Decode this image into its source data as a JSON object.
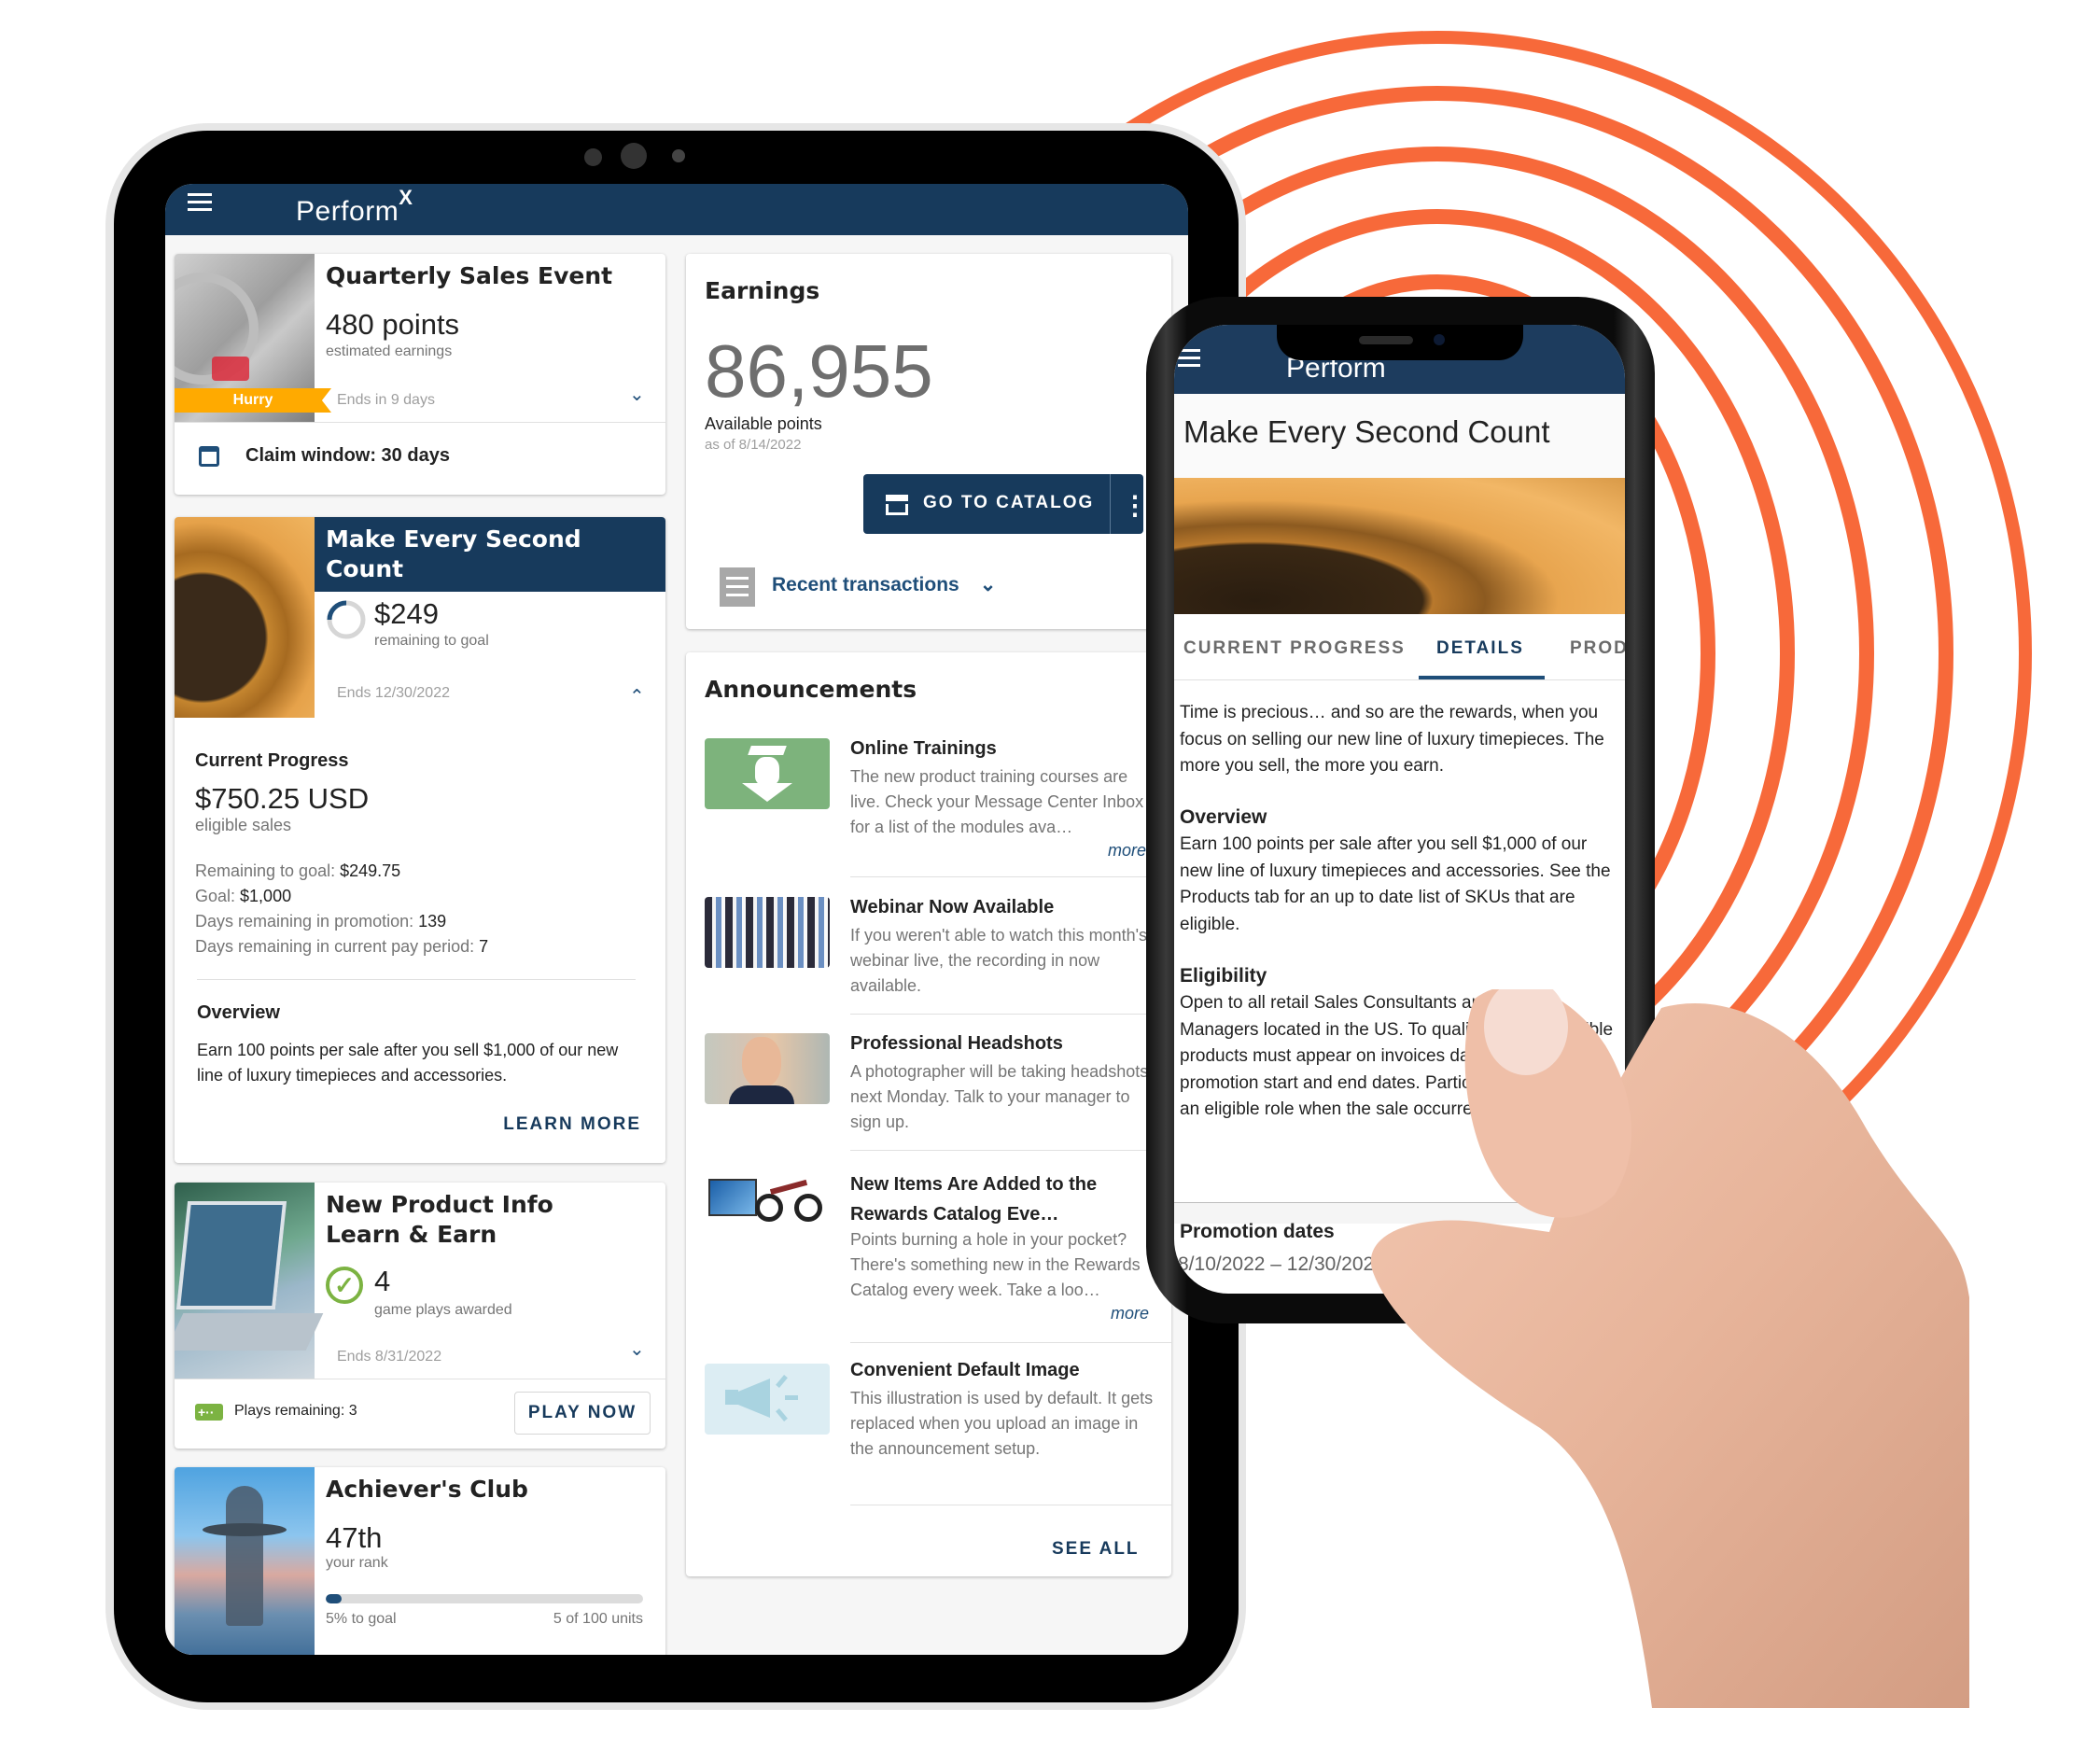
{
  "colors": {
    "brand_navy": "#173a5c",
    "accent_orange": "#f7693a",
    "hurry_yellow": "#ffaa00",
    "success_green": "#7cb342",
    "link_blue": "#1f4e79"
  },
  "tablet": {
    "app_header": {
      "logo_text": "Perform",
      "logo_super": "X",
      "menu_icon": "hamburger-icon"
    },
    "cards": {
      "quarterly": {
        "title": "Quarterly Sales Event",
        "value": "480 points",
        "value_label": "estimated earnings",
        "badge": "Hurry",
        "ends": "Ends in 9 days",
        "footer_icon": "calendar-icon",
        "footer_text": "Claim window: 30 days"
      },
      "mesc": {
        "title_line1": "Make Every Second",
        "title_line2": "Count",
        "value": "$249",
        "value_label": "remaining to goal",
        "progress_fraction": 0.75,
        "ends": "Ends 12/30/2022",
        "progress_heading": "Current Progress",
        "sales_value": "$750.25 USD",
        "sales_label": "eligible sales",
        "stats": [
          {
            "label": "Remaining to goal: ",
            "value": "$249.75"
          },
          {
            "label": "Goal: ",
            "value": "$1,000"
          },
          {
            "label": "Days remaining in promotion: ",
            "value": "139"
          },
          {
            "label": "Days remaining in current pay period: ",
            "value": "7"
          }
        ],
        "overview_heading": "Overview",
        "overview_text": "Earn 100 points per sale after you sell $1,000 of our new line of luxury timepieces and accessories.",
        "learn_more": "LEARN MORE"
      },
      "newproduct": {
        "title_line1": "New Product Info",
        "title_line2": "Learn & Earn",
        "value": "4",
        "value_label": "game plays awarded",
        "ends": "Ends 8/31/2022",
        "footer_text": "Plays remaining: 3",
        "play_button": "PLAY NOW"
      },
      "achievers": {
        "title": "Achiever's Club",
        "value": "47th",
        "value_label": "your rank",
        "progress_percent": 5,
        "progress_left": "5% to goal",
        "progress_right": "5 of 100 units"
      }
    },
    "earnings": {
      "heading": "Earnings",
      "points": "86,955",
      "points_label": "Available points",
      "as_of": "as of 8/14/2022",
      "catalog_button": "GO TO CATALOG",
      "recent_transactions": "Recent transactions"
    },
    "announcements": {
      "heading": "Announcements",
      "items": [
        {
          "title": "Online Trainings",
          "desc": "The new product training courses are live. Check your Message Center Inbox for a list of the modules ava…",
          "more": "more"
        },
        {
          "title": "Webinar Now Available",
          "desc": "If you weren't able to watch this month's webinar live, the recording in now available."
        },
        {
          "title": "Professional Headshots",
          "desc": "A photographer will be taking headshots next Monday. Talk to your manager to sign up."
        },
        {
          "title": "New Items Are Added to the Rewards Catalog Eve…",
          "desc": "Points burning a hole in your pocket? There's something new in the Rewards Catalog every week. Take a loo…",
          "more": "more"
        },
        {
          "title": "Convenient Default Image",
          "desc": "This illustration is used by default. It gets replaced when you upload an image in the announcement setup."
        }
      ],
      "see_all": "SEE ALL"
    }
  },
  "phone": {
    "logo_text": "Perform",
    "page_title": "Make Every Second Count",
    "tabs": [
      {
        "label": "CURRENT PROGRESS",
        "active": false
      },
      {
        "label": "DETAILS",
        "active": true
      },
      {
        "label": "PROD",
        "active": false
      }
    ],
    "intro": "Time is precious… and so are the rewards, when you focus on selling our new line of luxury timepieces. The more you sell, the more you earn.",
    "overview_heading": "Overview",
    "overview_text": "Earn 100 points per sale after you sell $1,000 of our new line of luxury timepieces and accessories. See the Products tab for an up to date list of SKUs that are eligible.",
    "eligibility_heading": "Eligibility",
    "eligibility_text": "Open to all retail Sales Consultants and Store Managers located in the US. To qualify, sales of eligible products must appear on invoices dated between the promotion start and end dates. Participants must have an eligible role when the sale occurred.",
    "promo_dates_heading": "Promotion dates",
    "promo_dates": "8/10/2022 – 12/30/2022"
  }
}
